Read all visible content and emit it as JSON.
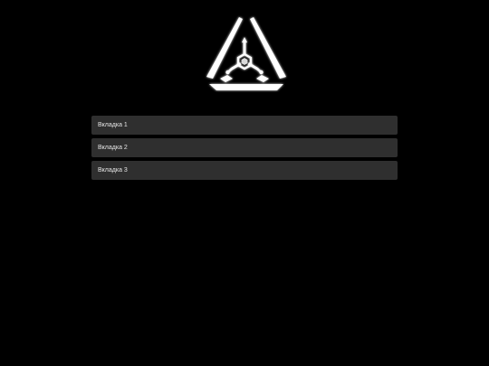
{
  "logo": {
    "icon": "triangle-hexagon-logo"
  },
  "tabs": [
    {
      "label": "Вкладка 1"
    },
    {
      "label": "Вкладка 2"
    },
    {
      "label": "Вкладка 3"
    }
  ],
  "colors": {
    "background": "#000000",
    "tab_background": "#2f2f2f",
    "tab_text": "#e6e6e6",
    "logo": "#ffffff"
  }
}
